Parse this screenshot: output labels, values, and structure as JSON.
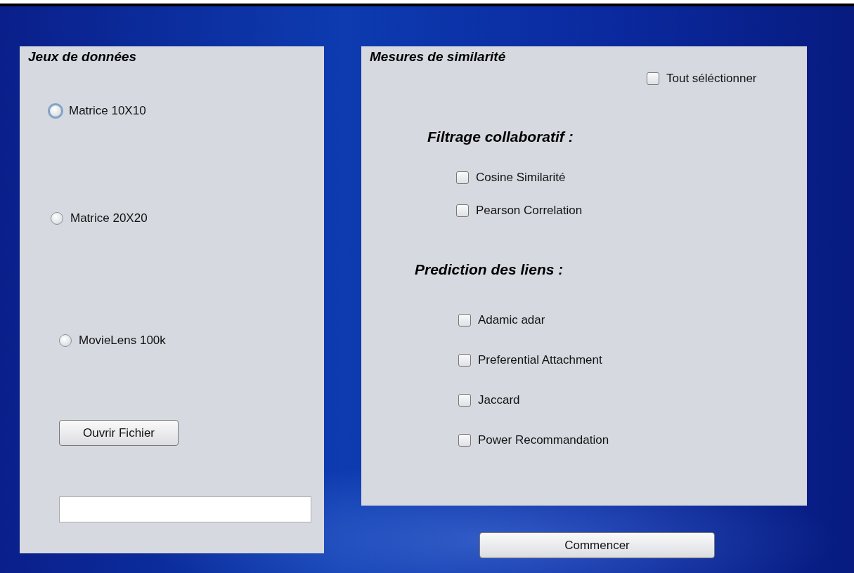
{
  "datasets": {
    "title": "Jeux de données",
    "options": [
      {
        "label": "Matrice 10X10",
        "selected": false,
        "focused": true
      },
      {
        "label": "Matrice 20X20",
        "selected": false,
        "focused": false
      },
      {
        "label": "MovieLens 100k",
        "selected": false,
        "focused": false
      }
    ],
    "open_button": "Ouvrir Fichier"
  },
  "similarity": {
    "title": "Mesures de similarité",
    "select_all": {
      "label": "Tout séléctionner",
      "checked": false
    },
    "groups": [
      {
        "heading": "Filtrage collaboratif :",
        "measures": [
          {
            "label": "Cosine Similarité",
            "checked": false
          },
          {
            "label": "Pearson Correlation",
            "checked": false
          }
        ]
      },
      {
        "heading": "Prediction des liens :",
        "measures": [
          {
            "label": "Adamic adar",
            "checked": false
          },
          {
            "label": "Preferential Attachment",
            "checked": false
          },
          {
            "label": "Jaccard",
            "checked": false
          },
          {
            "label": "Power Recommandation",
            "checked": false
          }
        ]
      }
    ]
  },
  "start_button": "Commencer"
}
